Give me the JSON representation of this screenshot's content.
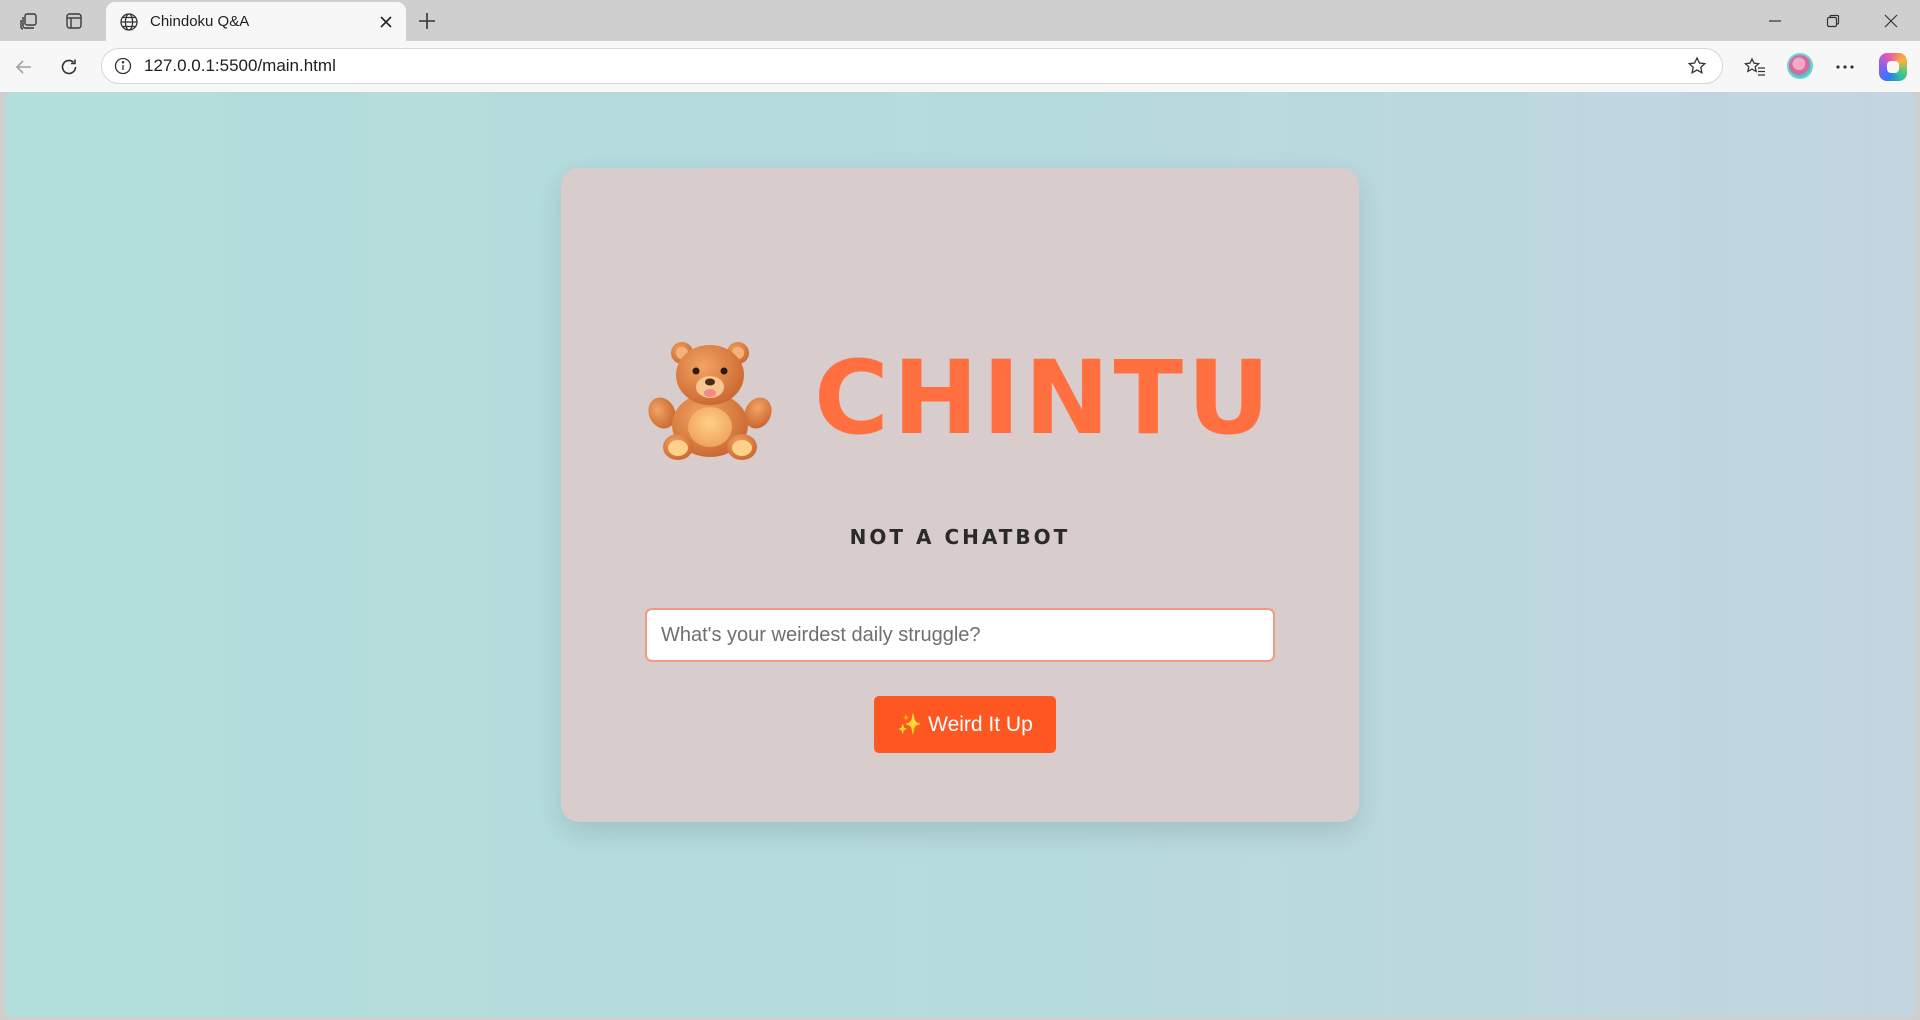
{
  "browser": {
    "tab": {
      "title": "Chindoku Q&A",
      "favicon": "globe-icon"
    },
    "address_bar": {
      "url": "127.0.0.1:5500/main.html"
    },
    "icons": {
      "workspaces": "workspaces-icon",
      "tab_actions": "tab-actions-icon",
      "new_tab": "plus-icon",
      "back": "back-arrow-icon",
      "refresh": "refresh-icon",
      "site_info": "info-icon",
      "favorite": "star-icon",
      "favorites": "favorites-icon",
      "more": "more-icon",
      "copilot": "copilot-icon"
    }
  },
  "page": {
    "brand": {
      "title": "CHINTU",
      "mascot": "teddy-bear-icon",
      "title_color": "#ff6f3f"
    },
    "subtitle": "NOT A CHATBOT",
    "question_input": {
      "placeholder": "What's your weirdest daily struggle?",
      "value": ""
    },
    "submit_button": {
      "icon": "sparkles-icon",
      "label": "Weird It Up",
      "color": "#ff5722"
    },
    "colors": {
      "card": "#d8cccc",
      "background_start": "#b2dedc",
      "background_end": "#c2d5e1"
    }
  }
}
